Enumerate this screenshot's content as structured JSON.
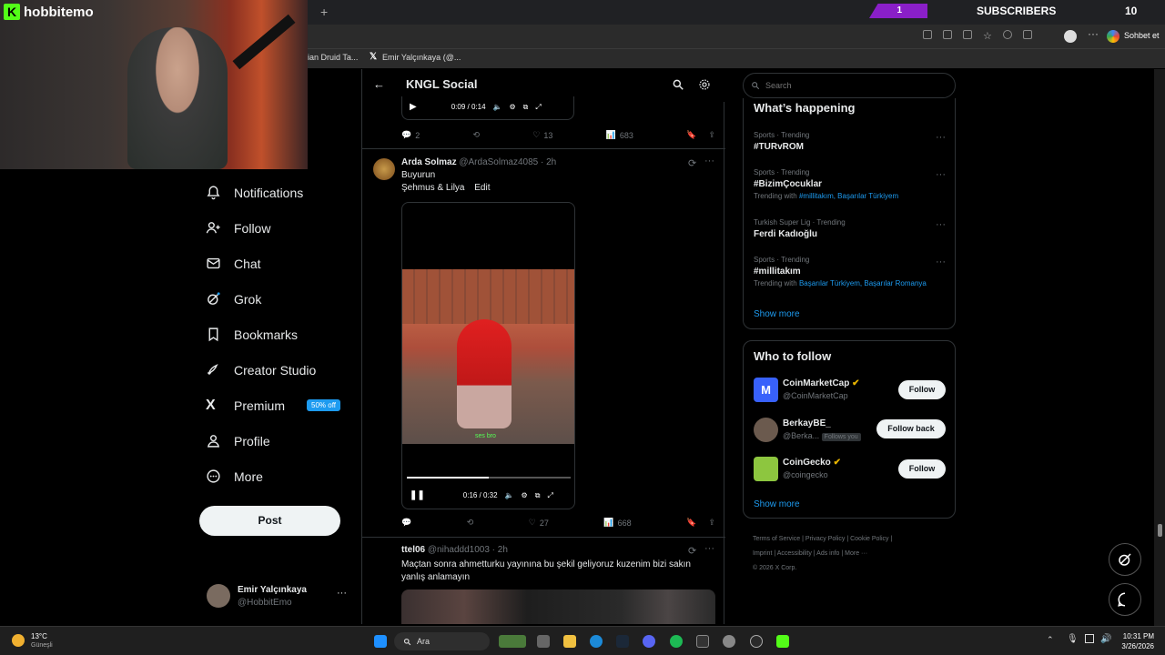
{
  "stream": {
    "brand": "hobbitemo",
    "subs_badge": "1",
    "subs_label": "SUBSCRIBERS",
    "subs_count": "10"
  },
  "browser": {
    "bookmarks": [
      "ian Druid Ta...",
      "Emir Yalçınkaya (@..."
    ],
    "chat_button": "Sohbet et"
  },
  "nav": {
    "items": [
      {
        "label": "Notifications",
        "icon": "bell-icon"
      },
      {
        "label": "Follow",
        "icon": "person-plus-icon"
      },
      {
        "label": "Chat",
        "icon": "mail-icon"
      },
      {
        "label": "Grok",
        "icon": "grok-icon"
      },
      {
        "label": "Bookmarks",
        "icon": "bookmark-icon"
      },
      {
        "label": "Creator Studio",
        "icon": "rocket-icon"
      },
      {
        "label": "Premium",
        "icon": "x-logo-icon"
      },
      {
        "label": "Profile",
        "icon": "person-icon"
      },
      {
        "label": "More",
        "icon": "more-circle-icon"
      }
    ],
    "premium_badge": "50% off",
    "post": "Post"
  },
  "account": {
    "name": "Emir Yalçınkaya",
    "handle": "@HobbitEmo"
  },
  "header": {
    "title": "KNGL Social"
  },
  "feed": {
    "top_video": {
      "time": "0:09 / 0:14"
    },
    "top_stats": {
      "replies": "2",
      "reposts": "",
      "likes": "13",
      "views": "683"
    },
    "tweet1": {
      "name": "Arda Solmaz",
      "handle": "@ArdaSolmaz4085 · 2h",
      "line1": "Buyurun",
      "line2": "Şehmus & Lilya",
      "edit": "Edit",
      "time": "0:16 / 0:32",
      "progress": 0.5,
      "caption": "ses bro",
      "stats": {
        "replies": "",
        "reposts": "",
        "likes": "27",
        "views": "668"
      }
    },
    "tweet2": {
      "name": "ttel06",
      "handle": "@nihaddd1003 · 2h",
      "text": "Maçtan sonra ahmetturku yayınına bu şekil geliyoruz kuzenim bizi sakın yanlış anlamayın"
    }
  },
  "search": {
    "placeholder": "Search"
  },
  "trends": {
    "title": "What’s happening",
    "items": [
      {
        "cat": "Sports · Trending",
        "name": "#TURvROM",
        "sub": ""
      },
      {
        "cat": "Sports · Trending",
        "name": "#BizimÇocuklar",
        "sub_prefix": "Trending with ",
        "sub": "#millitakım, Başarılar Türkiyem"
      },
      {
        "cat": "Turkish Super Lig · Trending",
        "name": "Ferdi Kadıoğlu",
        "sub": ""
      },
      {
        "cat": "Sports · Trending",
        "name": "#millitakım",
        "sub_prefix": "Trending with ",
        "sub": "Başarılar Türkiyem, Başarılar Romanya"
      }
    ],
    "show_more": "Show more"
  },
  "who": {
    "title": "Who to follow",
    "items": [
      {
        "name": "CoinMarketCap",
        "handle": "@CoinMarketCap",
        "btn": "Follow"
      },
      {
        "name": "BerkayBE_",
        "handle": "@Berka...",
        "tag": "Follows you",
        "btn": "Follow back"
      },
      {
        "name": "CoinGecko",
        "handle": "@coingecko",
        "btn": "Follow"
      }
    ],
    "show_more": "Show more"
  },
  "footer": {
    "links1": "Terms of Service  |  Privacy Policy  |  Cookie Policy  |",
    "links2": "Imprint  |  Accessibility  |  Ads info  |  More ···",
    "copy": "© 2026 X Corp."
  },
  "taskbar": {
    "weather_temp": "13°C",
    "weather_desc": "Güneşli",
    "search": "Ara",
    "time": "10:31 PM",
    "date": "3/26/2026"
  },
  "colors": {
    "accent": "#1d9bf0",
    "kick": "#53fc18",
    "subs": "#8a1fc8"
  }
}
